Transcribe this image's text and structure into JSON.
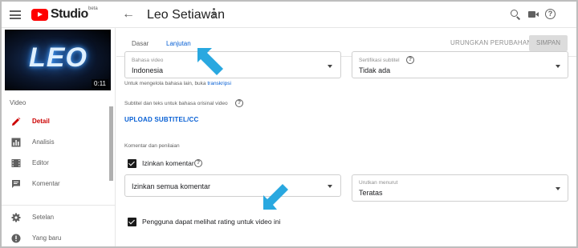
{
  "header": {
    "app_name": "Studio",
    "beta": "beta",
    "channel_title": "Leo Setiawan"
  },
  "thumbnail": {
    "text": "LEO",
    "duration": "0:11"
  },
  "sidebar": {
    "section_label": "Video",
    "items": [
      {
        "label": "Detail",
        "icon": "pencil-icon",
        "active": true
      },
      {
        "label": "Analisis",
        "icon": "analytics-icon"
      },
      {
        "label": "Editor",
        "icon": "film-icon"
      },
      {
        "label": "Komentar",
        "icon": "comment-icon"
      }
    ],
    "bottom_items": [
      {
        "label": "Setelan",
        "icon": "gear-icon"
      },
      {
        "label": "Yang baru",
        "icon": "alert-icon"
      }
    ]
  },
  "tabs": [
    {
      "label": "Dasar"
    },
    {
      "label": "Lanjutan",
      "active": true
    }
  ],
  "actions": {
    "undo_label": "URUNGKAN PERUBAHAN",
    "save_label": "SIMPAN"
  },
  "form": {
    "video_language": {
      "label": "Bahasa video",
      "value": "Indonesia"
    },
    "subtitle_cert": {
      "label": "Sertifikasi subtitel",
      "value": "Tidak ada"
    },
    "language_helper": {
      "text": "Untuk mengelola bahasa lain, buka",
      "link": "transkripsi"
    },
    "subtitles_label": "Subtitel dan teks untuk bahasa orisinal video",
    "upload_label": "UPLOAD SUBTITEL/CC",
    "comments_section_label": "Komentar dan penilaian",
    "allow_comments": {
      "label": "Izinkan komentar",
      "checked": true
    },
    "comment_mode": {
      "value": "Izinkan semua komentar"
    },
    "sort_by": {
      "label": "Urutkan menurut",
      "value": "Teratas"
    },
    "show_rating": {
      "label": "Pengguna dapat melihat rating untuk video ini",
      "checked": true
    }
  },
  "colors": {
    "accent": "#065fd4",
    "active_sidebar": "#cc0000",
    "annotation_arrow": "#29a8e0",
    "youtube_red": "#ff0000"
  }
}
